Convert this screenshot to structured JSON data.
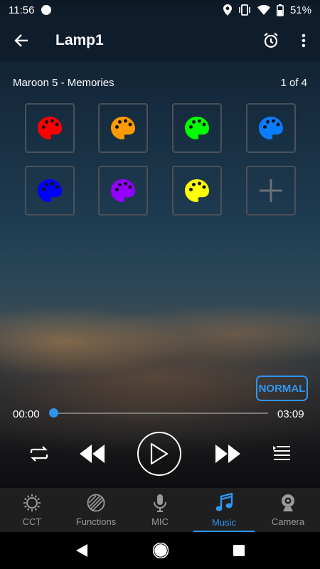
{
  "status_bar": {
    "time": "11:56",
    "battery": "51%"
  },
  "app_bar": {
    "title": "Lamp1"
  },
  "player": {
    "song": "Maroon 5 - Memories",
    "page": "1 of 4",
    "mode": "NORMAL",
    "elapsed": "00:00",
    "duration": "03:09",
    "progress": 0
  },
  "palette_tiles": [
    {
      "color": "#ff0000"
    },
    {
      "color": "#ff9900"
    },
    {
      "color": "#00ff00"
    },
    {
      "color": "#0a7cff"
    },
    {
      "color": "#0000ff"
    },
    {
      "color": "#9400ff"
    },
    {
      "color": "#ffff00"
    }
  ],
  "icons": {
    "palette": "palette-icon",
    "add": "plus-icon",
    "repeat": "repeat-icon",
    "rewind": "rewind-icon",
    "play": "play-icon",
    "fast_forward": "fast-forward-icon",
    "playlist": "playlist-icon"
  },
  "bottom_nav": [
    {
      "label": "CCT",
      "icon": "sun-icon",
      "active": false
    },
    {
      "label": "Functions",
      "icon": "stripes-icon",
      "active": false
    },
    {
      "label": "MIC",
      "icon": "mic-icon",
      "active": false
    },
    {
      "label": "Music",
      "icon": "music-note-icon",
      "active": true
    },
    {
      "label": "Camera",
      "icon": "webcam-icon",
      "active": false
    }
  ],
  "colors": {
    "accent": "#2f95f0",
    "tile_border": "#4b5159",
    "nav_inactive": "#9a9a9a"
  }
}
